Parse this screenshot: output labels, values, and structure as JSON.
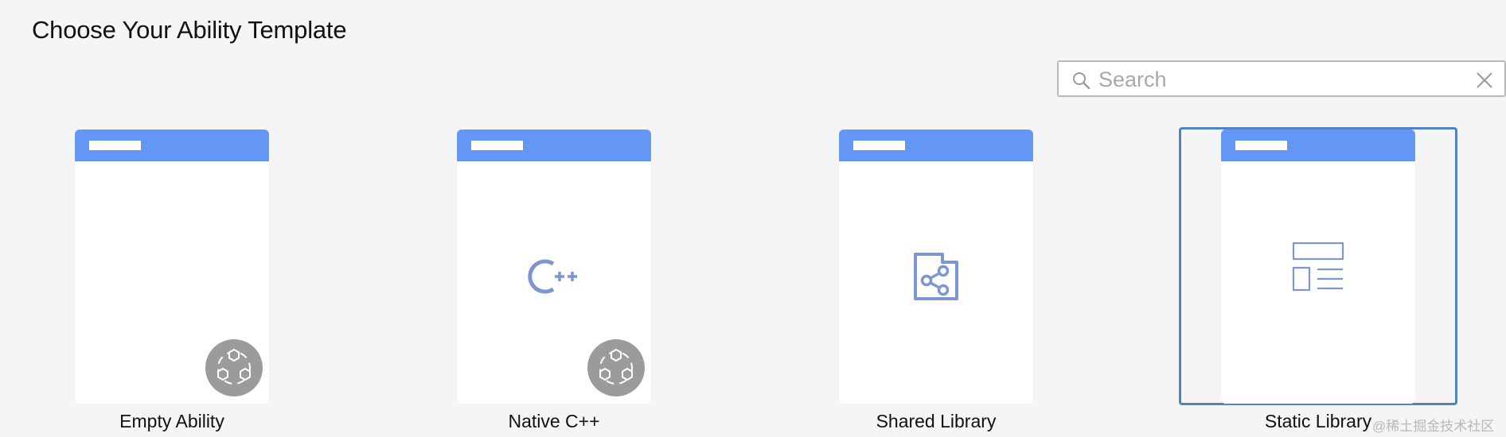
{
  "header": {
    "title": "Choose Your Ability Template"
  },
  "search": {
    "placeholder": "Search",
    "value": "",
    "search_icon": "search-icon",
    "clear_icon": "close-icon"
  },
  "templates": [
    {
      "label": "Empty Ability",
      "icon": "none",
      "badge": "cloud-hexagon-icon",
      "selected": false
    },
    {
      "label": "Native C++",
      "icon": "cpp-icon",
      "badge": "cloud-hexagon-icon",
      "selected": false
    },
    {
      "label": "Shared Library",
      "icon": "shared-library-icon",
      "badge": null,
      "selected": false
    },
    {
      "label": "Static Library",
      "icon": "static-library-icon",
      "badge": null,
      "selected": true
    }
  ],
  "colors": {
    "background": "#f5f5f5",
    "card_header": "#6496f5",
    "icon_blue": "#7e96cf",
    "selection_border": "#4f82c6",
    "badge_gray": "#9b9b9b"
  },
  "watermark": "@稀土掘金技术社区"
}
